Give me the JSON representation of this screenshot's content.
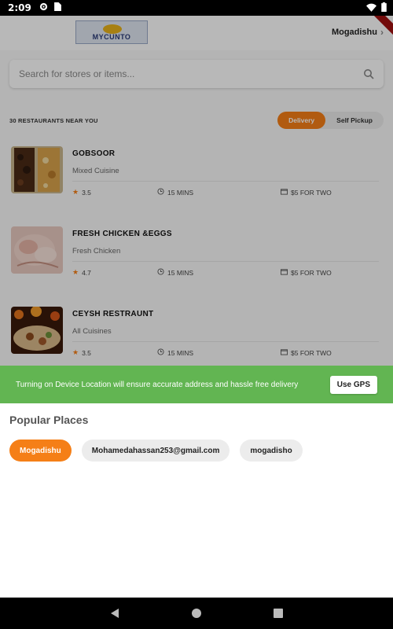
{
  "status_bar": {
    "time": "2:09"
  },
  "header": {
    "city": "Mogadishu",
    "logo_text": "MYCUNTO"
  },
  "search": {
    "placeholder": "Search for stores or items..."
  },
  "list_header": {
    "count_label": "30 RESTAURANTS NEAR YOU",
    "toggle": [
      "Delivery",
      "Self Pickup"
    ],
    "selected": "Delivery"
  },
  "restaurants": [
    {
      "name": "GOBSOOR",
      "cuisine": "Mixed Cuisine",
      "rating": "3.5",
      "time": "15 MINS",
      "cost": "$5 FOR TWO"
    },
    {
      "name": "FRESH CHICKEN &EGGS",
      "cuisine": "Fresh Chicken",
      "rating": "4.7",
      "time": "15 MINS",
      "cost": "$5 FOR TWO"
    },
    {
      "name": "CEYSH RESTRAUNT",
      "cuisine": "All Cuisines",
      "rating": "3.5",
      "time": "15 MINS",
      "cost": "$5 FOR TWO"
    }
  ],
  "gps_banner": {
    "message": "Turning on Device Location will ensure accurate address and hassle free delivery",
    "button": "Use GPS"
  },
  "popular": {
    "title": "Popular Places",
    "places": [
      "Mogadishu",
      "Mohamedahassan253@gmail.com",
      "mogadisho"
    ]
  },
  "colors": {
    "accent": "#f57f17",
    "gps_green": "#62b552"
  }
}
